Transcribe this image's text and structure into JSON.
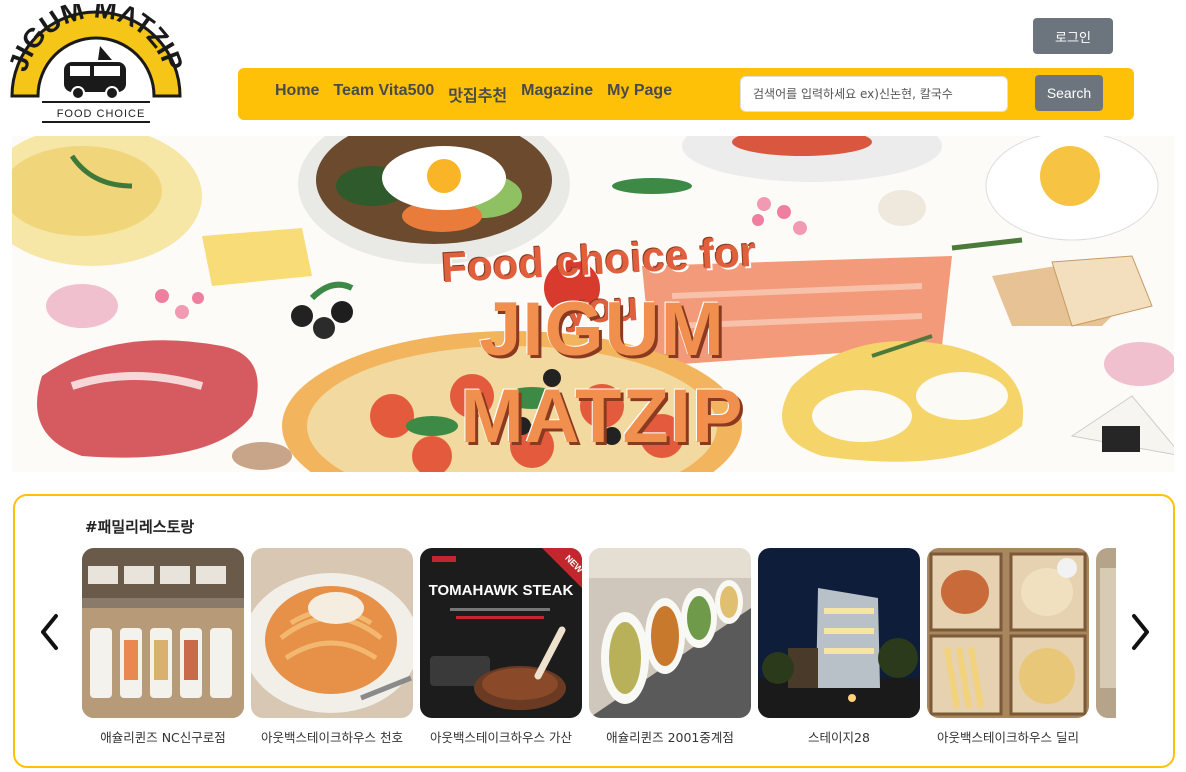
{
  "logo": {
    "arc_text": "JIGUM MATZIP",
    "subtitle": "FOOD CHOICE"
  },
  "header": {
    "login_label": "로그인"
  },
  "navbar": {
    "links": [
      "Home",
      "Team Vita500",
      "맛집추천",
      "Magazine",
      "My Page"
    ],
    "search_placeholder": "검색어를 입력하세요 ex)신논현, 칼국수",
    "search_button_label": "Search"
  },
  "banner": {
    "tagline": "Food choice for you",
    "title": "JIGUM MATZIP"
  },
  "section": {
    "title": "#패밀리레스토랑",
    "prev_icon": "chevron-left-icon",
    "next_icon": "chevron-right-icon",
    "cards": [
      {
        "name": "애슐리퀸즈 NC신구로점"
      },
      {
        "name": "아웃백스테이크하우스 천호"
      },
      {
        "name": "아웃백스테이크하우스 가산",
        "image_text": "TOMAHAWK STEAK",
        "badge": "NEW"
      },
      {
        "name": "애슐리퀸즈 2001중계점"
      },
      {
        "name": "스테이지28"
      },
      {
        "name": "아웃백스테이크하우스 딜리"
      }
    ]
  },
  "colors": {
    "accent": "#ffc107",
    "button_gray": "#6c757d",
    "banner_text": "#f08f4e"
  }
}
